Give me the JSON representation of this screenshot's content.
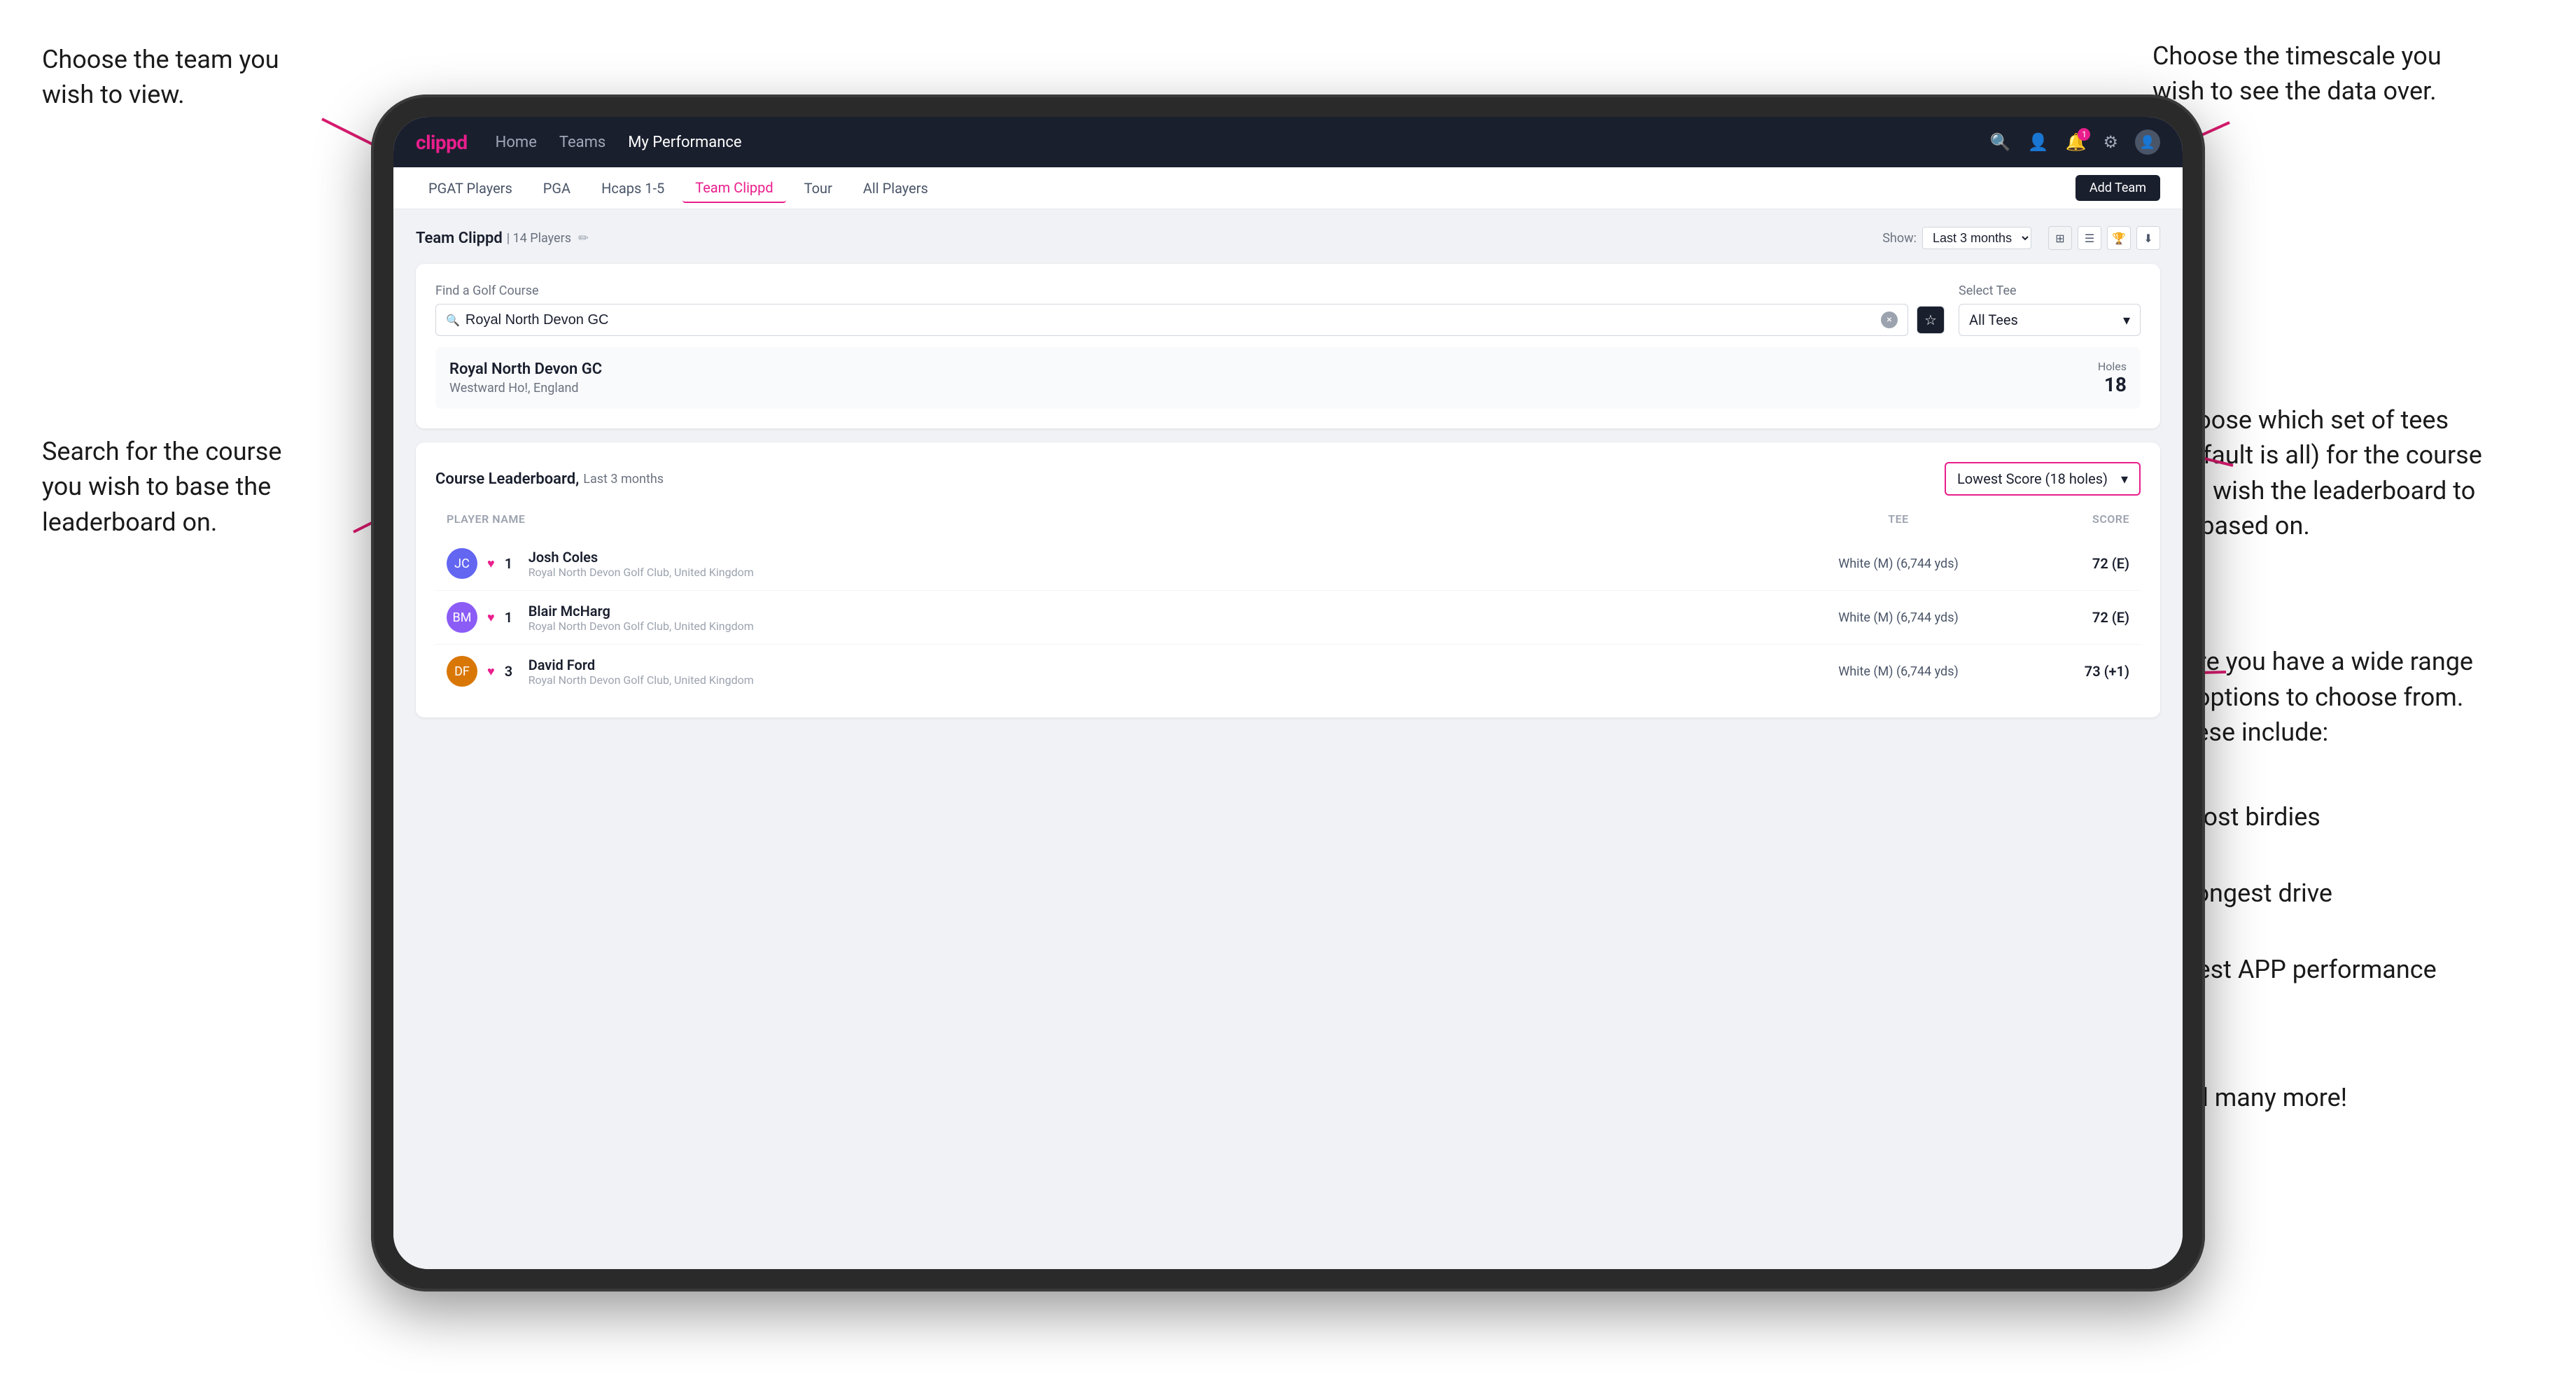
{
  "annotations": {
    "top_left": "Choose the team you\nwish to view.",
    "top_right": "Choose the timescale you\nwish to see the data over.",
    "middle_right_title": "Choose which set of tees\n(default is all) for the course\nyou wish the leaderboard to\nbe based on.",
    "left_middle": "Search for the course\nyou wish to base the\nleaderboard on.",
    "bottom_right_title": "Here you have a wide range\nof options to choose from.\nThese include:",
    "bullet1": "Most birdies",
    "bullet2": "Longest drive",
    "bullet3": "Best APP performance",
    "and_more": "and many more!"
  },
  "navbar": {
    "logo": "clippd",
    "links": [
      {
        "label": "Home",
        "active": false
      },
      {
        "label": "Teams",
        "active": false
      },
      {
        "label": "My Performance",
        "active": true
      }
    ],
    "icons": {
      "search": "🔍",
      "people": "👤",
      "bell": "🔔",
      "settings": "⚙",
      "avatar": "👤"
    }
  },
  "subnav": {
    "items": [
      {
        "label": "PGAT Players",
        "active": false
      },
      {
        "label": "PGA",
        "active": false
      },
      {
        "label": "Hcaps 1-5",
        "active": false
      },
      {
        "label": "Team Clippd",
        "active": true
      },
      {
        "label": "Tour",
        "active": false
      },
      {
        "label": "All Players",
        "active": false
      }
    ],
    "add_team_btn": "Add Team"
  },
  "team_header": {
    "title": "Team Clippd",
    "count": "| 14 Players",
    "show_label": "Show:",
    "show_value": "Last 3 months"
  },
  "course_search": {
    "find_label": "Find a Golf Course",
    "search_value": "Royal North Devon GC",
    "tee_label": "Select Tee",
    "tee_value": "All Tees"
  },
  "course_result": {
    "name": "Royal North Devon GC",
    "location": "Westward Ho!, England",
    "holes_label": "Holes",
    "holes": "18"
  },
  "leaderboard": {
    "title": "Course Leaderboard,",
    "subtitle": "Last 3 months",
    "score_selector": "Lowest Score (18 holes)",
    "columns": {
      "player": "PLAYER NAME",
      "tee": "TEE",
      "score": "SCORE"
    },
    "players": [
      {
        "rank": "1",
        "name": "Josh Coles",
        "club": "Royal North Devon Golf Club, United Kingdom",
        "tee": "White (M) (6,744 yds)",
        "score": "72 (E)"
      },
      {
        "rank": "1",
        "name": "Blair McHarg",
        "club": "Royal North Devon Golf Club, United Kingdom",
        "tee": "White (M) (6,744 yds)",
        "score": "72 (E)"
      },
      {
        "rank": "3",
        "name": "David Ford",
        "club": "Royal North Devon Golf Club, United Kingdom",
        "tee": "White (M) (6,744 yds)",
        "score": "73 (+1)"
      }
    ]
  }
}
